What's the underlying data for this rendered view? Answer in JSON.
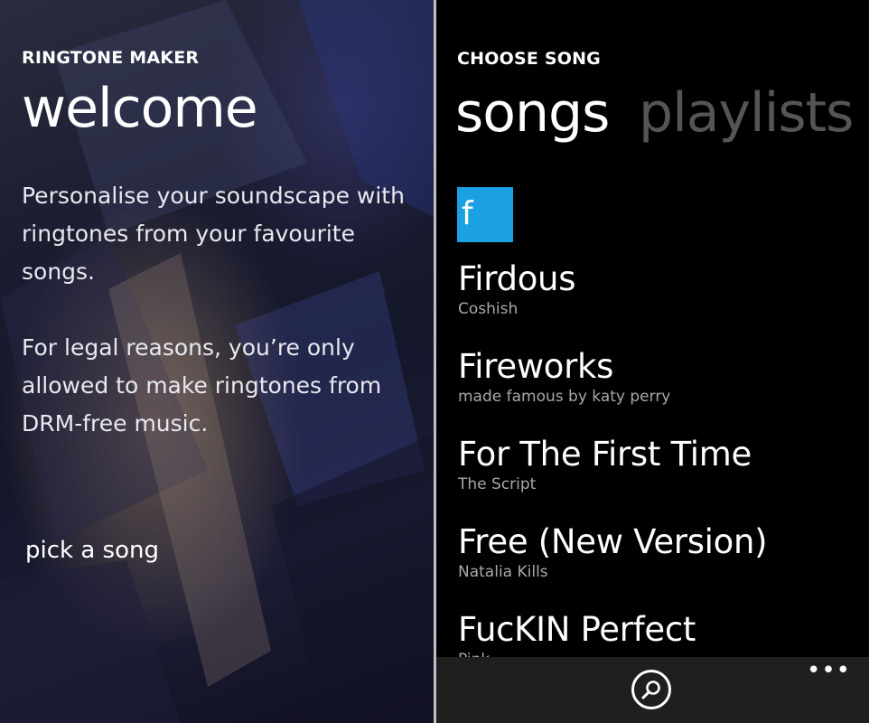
{
  "left_panel": {
    "app_title": "RINGTONE MAKER",
    "page_title": "welcome",
    "paragraph_1": "Personalise your soundscape with ringtones from your favourite songs.",
    "paragraph_2": "For legal reasons, you’re only allowed to make ringtones from DRM-free music.",
    "pick_song_label": "pick a song"
  },
  "right_panel": {
    "app_title": "CHOOSE SONG",
    "pivot": {
      "active": "songs",
      "inactive": "playlists"
    },
    "jump_letter": "f",
    "songs": [
      {
        "title": "Firdous",
        "artist": "Coshish"
      },
      {
        "title": "Fireworks",
        "artist": "made famous by katy perry"
      },
      {
        "title": "For The First Time",
        "artist": "The Script"
      },
      {
        "title": "Free (New Version)",
        "artist": "Natalia Kills"
      },
      {
        "title": "FucKIN Perfect",
        "artist": "Pink"
      }
    ],
    "appbar": {
      "search_icon": "search-icon",
      "more_label": "•••"
    }
  },
  "colors": {
    "accent": "#1ba1e2",
    "secondary_text": "#a8a8a8",
    "inactive_pivot": "#555555",
    "appbar_bg": "#1f1f1f"
  }
}
